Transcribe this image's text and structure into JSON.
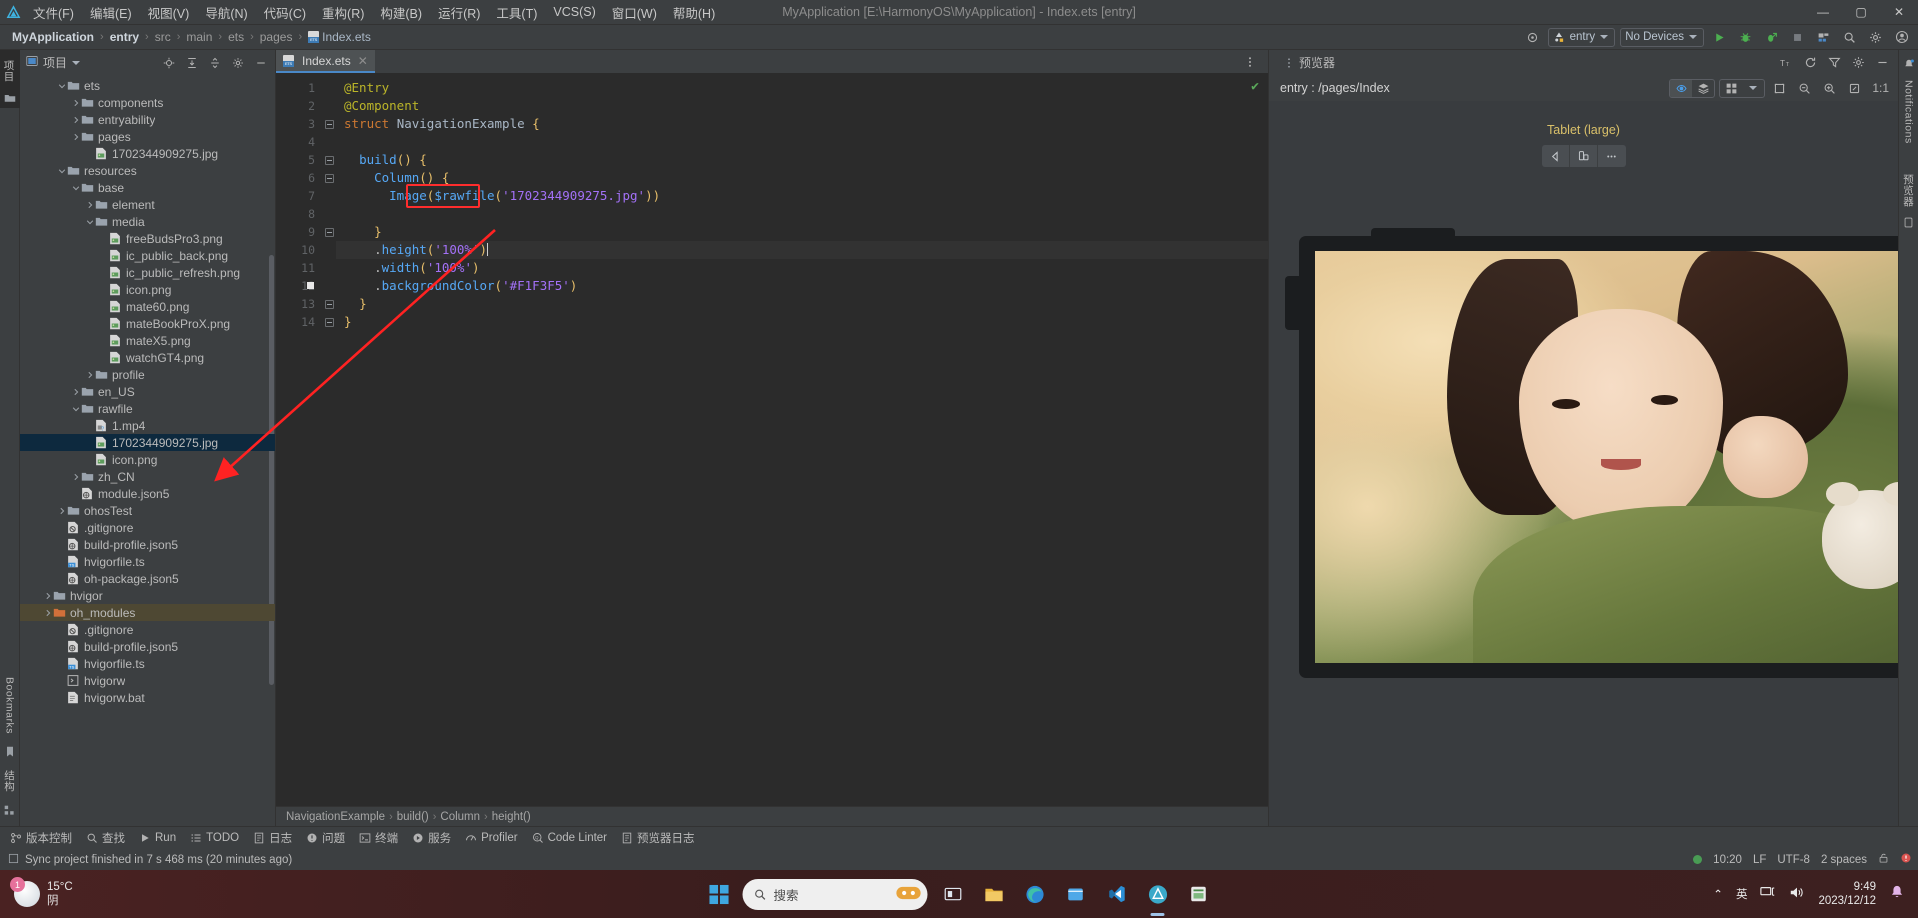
{
  "window": {
    "title": "MyApplication [E:\\HarmonyOS\\MyApplication] - Index.ets [entry]",
    "minimize": "—",
    "maximize": "▢",
    "close": "✕"
  },
  "menu": {
    "items": [
      {
        "label": "文件(F)"
      },
      {
        "label": "编辑(E)"
      },
      {
        "label": "视图(V)"
      },
      {
        "label": "导航(N)"
      },
      {
        "label": "代码(C)"
      },
      {
        "label": "重构(R)"
      },
      {
        "label": "构建(B)"
      },
      {
        "label": "运行(R)"
      },
      {
        "label": "工具(T)"
      },
      {
        "label": "VCS(S)"
      },
      {
        "label": "窗口(W)"
      },
      {
        "label": "帮助(H)"
      }
    ]
  },
  "navbar": {
    "breadcrumbs": [
      {
        "label": "MyApplication",
        "style": "bold"
      },
      {
        "label": "entry",
        "style": "bold"
      },
      {
        "label": "src",
        "style": "dim"
      },
      {
        "label": "main",
        "style": "dim"
      },
      {
        "label": "ets",
        "style": "dim"
      },
      {
        "label": "pages",
        "style": "dim"
      },
      {
        "label": "Index.ets",
        "style": "file"
      }
    ],
    "separator": "›",
    "run_config": "entry",
    "device_selector": "No Devices",
    "icons": [
      "target-icon",
      "run-icon",
      "debug-icon",
      "profile-debug-icon",
      "stop-icon",
      "device-manager-icon",
      "search-icon",
      "settings-icon",
      "account-icon"
    ]
  },
  "project_panel": {
    "title": "项目",
    "header_icons": [
      "locate-file-icon",
      "expand-all-icon",
      "collapse-all-icon",
      "settings-icon",
      "hide-icon"
    ],
    "tree": [
      {
        "label": "ets",
        "indent": 2,
        "arrow": "down",
        "icon": "folder",
        "state": "normal"
      },
      {
        "label": "components",
        "indent": 3,
        "arrow": "right",
        "icon": "folder",
        "state": "normal"
      },
      {
        "label": "entryability",
        "indent": 3,
        "arrow": "right",
        "icon": "folder",
        "state": "normal"
      },
      {
        "label": "pages",
        "indent": 3,
        "arrow": "right",
        "icon": "folder",
        "state": "normal"
      },
      {
        "label": "1702344909275.jpg",
        "indent": 4,
        "arrow": "none",
        "icon": "image",
        "state": "normal"
      },
      {
        "label": "resources",
        "indent": 2,
        "arrow": "down",
        "icon": "folder",
        "state": "normal"
      },
      {
        "label": "base",
        "indent": 3,
        "arrow": "down",
        "icon": "folder",
        "state": "normal"
      },
      {
        "label": "element",
        "indent": 4,
        "arrow": "right",
        "icon": "folder",
        "state": "normal"
      },
      {
        "label": "media",
        "indent": 4,
        "arrow": "down",
        "icon": "folder",
        "state": "normal"
      },
      {
        "label": "freeBudsPro3.png",
        "indent": 5,
        "arrow": "none",
        "icon": "image",
        "state": "normal"
      },
      {
        "label": "ic_public_back.png",
        "indent": 5,
        "arrow": "none",
        "icon": "image",
        "state": "normal"
      },
      {
        "label": "ic_public_refresh.png",
        "indent": 5,
        "arrow": "none",
        "icon": "image",
        "state": "normal"
      },
      {
        "label": "icon.png",
        "indent": 5,
        "arrow": "none",
        "icon": "image",
        "state": "normal"
      },
      {
        "label": "mate60.png",
        "indent": 5,
        "arrow": "none",
        "icon": "image",
        "state": "normal"
      },
      {
        "label": "mateBookProX.png",
        "indent": 5,
        "arrow": "none",
        "icon": "image",
        "state": "normal"
      },
      {
        "label": "mateX5.png",
        "indent": 5,
        "arrow": "none",
        "icon": "image",
        "state": "normal"
      },
      {
        "label": "watchGT4.png",
        "indent": 5,
        "arrow": "none",
        "icon": "image",
        "state": "normal"
      },
      {
        "label": "profile",
        "indent": 4,
        "arrow": "right",
        "icon": "folder",
        "state": "normal"
      },
      {
        "label": "en_US",
        "indent": 3,
        "arrow": "right",
        "icon": "folder",
        "state": "normal"
      },
      {
        "label": "rawfile",
        "indent": 3,
        "arrow": "down",
        "icon": "folder",
        "state": "normal"
      },
      {
        "label": "1.mp4",
        "indent": 4,
        "arrow": "none",
        "icon": "video",
        "state": "normal"
      },
      {
        "label": "1702344909275.jpg",
        "indent": 4,
        "arrow": "none",
        "icon": "image",
        "state": "selected"
      },
      {
        "label": "icon.png",
        "indent": 4,
        "arrow": "none",
        "icon": "image",
        "state": "normal"
      },
      {
        "label": "zh_CN",
        "indent": 3,
        "arrow": "right",
        "icon": "folder",
        "state": "normal"
      },
      {
        "label": "module.json5",
        "indent": 3,
        "arrow": "none",
        "icon": "json",
        "state": "normal"
      },
      {
        "label": "ohosTest",
        "indent": 2,
        "arrow": "right",
        "icon": "folder",
        "state": "normal"
      },
      {
        "label": ".gitignore",
        "indent": 2,
        "arrow": "none",
        "icon": "gitignore",
        "state": "normal"
      },
      {
        "label": "build-profile.json5",
        "indent": 2,
        "arrow": "none",
        "icon": "json",
        "state": "normal"
      },
      {
        "label": "hvigorfile.ts",
        "indent": 2,
        "arrow": "none",
        "icon": "ts",
        "state": "normal"
      },
      {
        "label": "oh-package.json5",
        "indent": 2,
        "arrow": "none",
        "icon": "json",
        "state": "normal"
      },
      {
        "label": "hvigor",
        "indent": 1,
        "arrow": "right",
        "icon": "folder",
        "state": "normal"
      },
      {
        "label": "oh_modules",
        "indent": 1,
        "arrow": "right",
        "icon": "folder-orange",
        "state": "highlight"
      },
      {
        "label": ".gitignore",
        "indent": 2,
        "arrow": "none",
        "icon": "gitignore",
        "state": "normal"
      },
      {
        "label": "build-profile.json5",
        "indent": 2,
        "arrow": "none",
        "icon": "json",
        "state": "normal"
      },
      {
        "label": "hvigorfile.ts",
        "indent": 2,
        "arrow": "none",
        "icon": "ts",
        "state": "normal"
      },
      {
        "label": "hvigorw",
        "indent": 2,
        "arrow": "none",
        "icon": "script",
        "state": "normal"
      },
      {
        "label": "hvigorw.bat",
        "indent": 2,
        "arrow": "none",
        "icon": "file",
        "state": "normal"
      }
    ]
  },
  "editor": {
    "tab": {
      "label": "Index.ets",
      "close": "✕"
    },
    "lines": [
      {
        "n": 1,
        "fold": "none",
        "current": false
      },
      {
        "n": 2,
        "fold": "none",
        "current": false
      },
      {
        "n": 3,
        "fold": "open",
        "current": false
      },
      {
        "n": 4,
        "fold": "none",
        "current": false
      },
      {
        "n": 5,
        "fold": "open",
        "current": false
      },
      {
        "n": 6,
        "fold": "open",
        "current": false
      },
      {
        "n": 7,
        "fold": "none",
        "current": false
      },
      {
        "n": 8,
        "fold": "none",
        "current": false
      },
      {
        "n": 9,
        "fold": "close",
        "current": false
      },
      {
        "n": 10,
        "fold": "none",
        "current": true
      },
      {
        "n": 11,
        "fold": "none",
        "current": false
      },
      {
        "n": 12,
        "fold": "none",
        "current": false
      },
      {
        "n": 13,
        "fold": "close",
        "current": false
      },
      {
        "n": 14,
        "fold": "close",
        "current": false
      }
    ],
    "code_text": [
      "@Entry",
      "@Component",
      "struct NavigationExample {",
      "",
      "  build() {",
      "    Column() {",
      "      Image($rawfile('1702344909275.jpg'))",
      "",
      "    }",
      "    .height('100%')",
      "    .width('100%')",
      "    .backgroundColor('#F1F3F5')",
      "  }",
      "}"
    ],
    "highlight_box_target": "Image($rawfile(",
    "status_ok_icon": "checkmark-icon",
    "breadcrumbs": [
      "NavigationExample",
      "build()",
      "Column",
      "height()"
    ],
    "breadcrumb_sep": "›"
  },
  "preview": {
    "title": "预览器",
    "path": "entry : /pages/Index",
    "header_icons": [
      "font-size-icon",
      "refresh-icon",
      "filter-icon",
      "settings-icon",
      "hide-icon"
    ],
    "toolbar_icons": [
      "inspector-icon",
      "layers-icon",
      "grid-icon",
      "chevron-down-icon",
      "fit-icon",
      "zoom-out-icon",
      "zoom-in-icon",
      "actual-size-icon"
    ],
    "zoom_label": "1:1",
    "device_name": "Tablet (large)",
    "device_controls": [
      "rotate-back-icon",
      "orientation-icon",
      "more-icon"
    ]
  },
  "tool_window_bar": {
    "items": [
      {
        "label": "版本控制",
        "icon": "vcs-icon"
      },
      {
        "label": "查找",
        "icon": "search-icon"
      },
      {
        "label": "Run",
        "icon": "run-icon"
      },
      {
        "label": "TODO",
        "icon": "todo-icon"
      },
      {
        "label": "日志",
        "icon": "log-icon"
      },
      {
        "label": "问题",
        "icon": "problems-icon"
      },
      {
        "label": "终端",
        "icon": "terminal-icon"
      },
      {
        "label": "服务",
        "icon": "services-icon"
      },
      {
        "label": "Profiler",
        "icon": "profiler-icon"
      },
      {
        "label": "Code Linter",
        "icon": "linter-icon"
      },
      {
        "label": "预览器日志",
        "icon": "preview-log-icon"
      }
    ]
  },
  "statusbar": {
    "message": "Sync project finished in 7 s 468 ms (20 minutes ago)",
    "time": "10:20",
    "line_sep": "LF",
    "encoding": "UTF-8",
    "indent": "2 spaces",
    "icons": [
      "lock-icon",
      "error-icon"
    ]
  },
  "left_rail": {
    "top_tabs": [
      "项目"
    ],
    "bottom_tabs": [
      "Bookmarks",
      "结构"
    ]
  },
  "right_rail": {
    "tabs": [
      "Notifications",
      "预览器"
    ]
  },
  "taskbar": {
    "weather": {
      "temp": "15°C",
      "cond": "阴",
      "badge": "1"
    },
    "search_placeholder": "搜索",
    "apps": [
      "task-view-icon",
      "file-explorer-icon",
      "edge-icon",
      "store-icon",
      "vscode-icon",
      "deveco-icon",
      "app-icon"
    ],
    "tray": {
      "chevron": "⌃",
      "ime": "英",
      "network": "network-icon",
      "volume": "volume-icon",
      "time": "9:49",
      "date": "2023/12/12",
      "bell": "notification-icon"
    }
  },
  "colors": {
    "accent_blue": "#4a88c7",
    "selection_blue": "#0d293e",
    "highlight_red": "#ff2d2d",
    "background_color_value": "#F1F3F5"
  }
}
